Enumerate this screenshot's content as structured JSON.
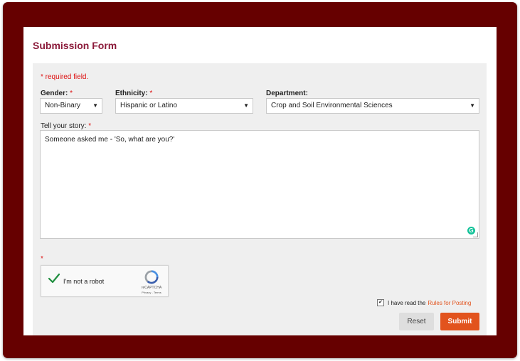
{
  "form": {
    "title": "Submission Form",
    "required_note": "* required field.",
    "required_marker": "*",
    "gender": {
      "label": "Gender:",
      "value": "Non-Binary"
    },
    "ethnicity": {
      "label": "Ethnicity:",
      "value": "Hispanic or Latino"
    },
    "department": {
      "label": "Department:",
      "value": "Crop and Soil Environmental Sciences"
    },
    "story": {
      "label": "Tell your story:",
      "value": "Someone asked me - 'So, what are you?'"
    },
    "captcha": {
      "label": "I'm not a robot",
      "brand": "reCAPTCHA",
      "terms": "Privacy - Terms"
    },
    "rules": {
      "text": "I have read the",
      "link": "Rules for Posting",
      "checked": true
    },
    "buttons": {
      "reset": "Reset",
      "submit": "Submit"
    }
  },
  "colors": {
    "frame": "#660000",
    "title": "#8b1a3a",
    "accent": "#e2531d",
    "required": "#dd1111",
    "panel": "#efefef"
  },
  "icons": [
    "caret-down-icon",
    "checkmark-icon",
    "recaptcha-logo-icon",
    "grammarly-icon",
    "resize-handle-icon",
    "checkbox-icon"
  ]
}
